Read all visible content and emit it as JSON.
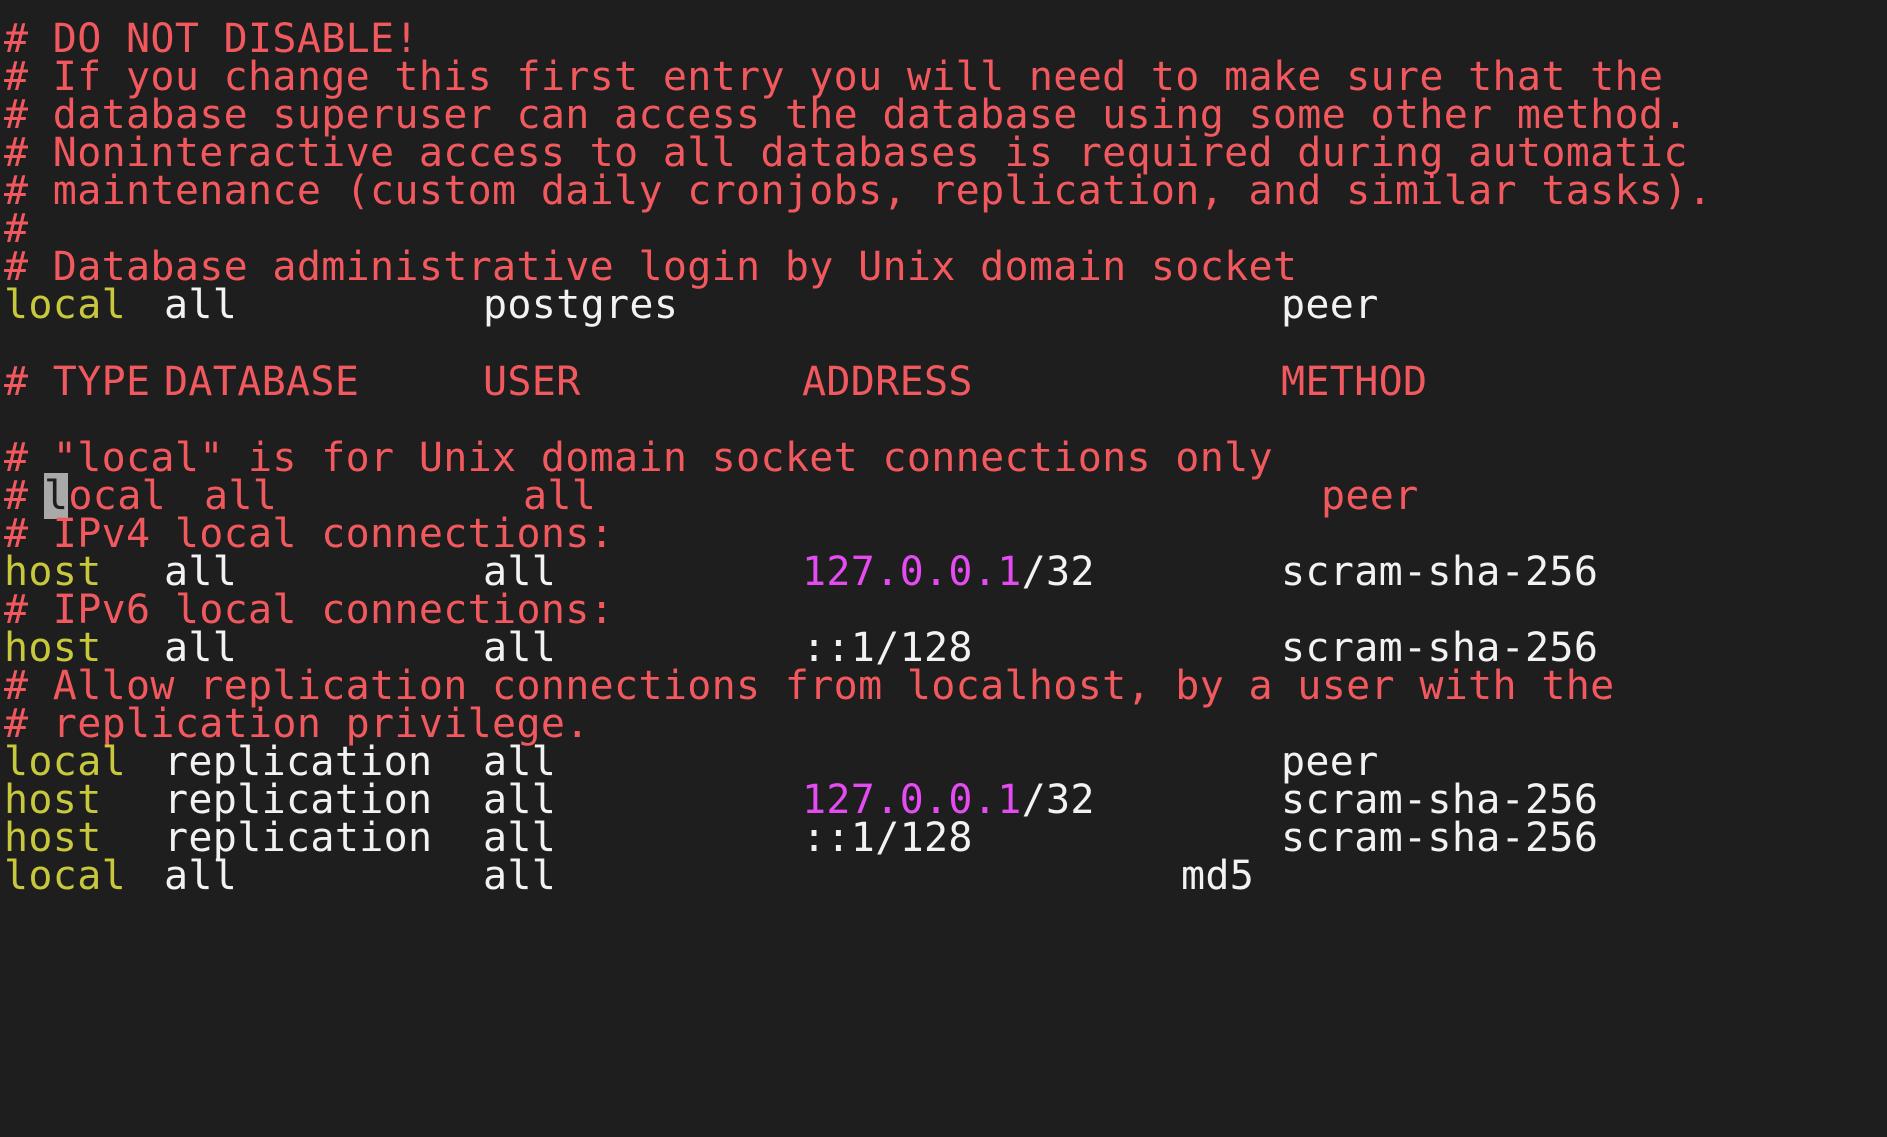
{
  "comments": {
    "c1": "# DO NOT DISABLE!",
    "c2": "# If you change this first entry you will need to make sure that the",
    "c3": "# database superuser can access the database using some other method.",
    "c4": "# Noninteractive access to all databases is required during automatic",
    "c5": "# maintenance (custom daily cronjobs, replication, and similar tasks).",
    "c6": "#",
    "c7": "# Database administrative login by Unix domain socket",
    "local_comment": "# \"local\" is for Unix domain socket connections only",
    "ipv4_comment": "# IPv4 local connections:",
    "ipv6_comment": "# IPv6 local connections:",
    "repl_comment1": "# Allow replication connections from localhost, by a user with the",
    "repl_comment2": "# replication privilege."
  },
  "header": {
    "type": "# TYPE",
    "database": "DATABASE",
    "user": "USER",
    "address": "ADDRESS",
    "method": "METHOD"
  },
  "commented_entry": {
    "prefix": "# ",
    "cursor_char": "l",
    "type_rest": "ocal",
    "database": "all",
    "user": "all",
    "method": "peer"
  },
  "entries": [
    {
      "type": "local",
      "database": "all",
      "user": "postgres",
      "ip": "",
      "suffix": "",
      "method": "peer"
    },
    {
      "type": "host",
      "database": "all",
      "user": "all",
      "ip": "127.0.0.1",
      "suffix": "/32",
      "method": "scram-sha-256"
    },
    {
      "type": "host",
      "database": "all",
      "user": "all",
      "ip": "",
      "suffix": "::1/128",
      "method": "scram-sha-256"
    },
    {
      "type": "local",
      "database": "replication",
      "user": "all",
      "ip": "",
      "suffix": "",
      "method": "peer"
    },
    {
      "type": "host",
      "database": "replication",
      "user": "all",
      "ip": "127.0.0.1",
      "suffix": "/32",
      "method": "scram-sha-256"
    },
    {
      "type": "host",
      "database": "replication",
      "user": "all",
      "ip": "",
      "suffix": "::1/128",
      "method": "scram-sha-256"
    },
    {
      "type": "local",
      "database": "all",
      "user": "all",
      "ip": "",
      "suffix": "",
      "method": "md5"
    }
  ],
  "colors": {
    "background": "#1e1e1e",
    "comment": "#f2595e",
    "keyword": "#c8c83c",
    "text": "#f2f2f2",
    "ip_address": "#e44bf0",
    "cursor": "#a9a9a9"
  }
}
